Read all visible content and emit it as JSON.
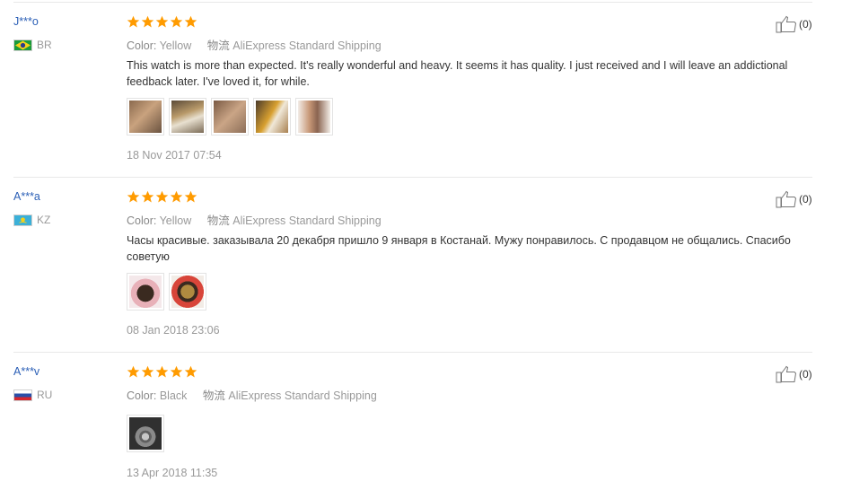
{
  "reviews": [
    {
      "user": "J***o",
      "country": "BR",
      "rating": 5,
      "color_label": "Color:",
      "color_value": "Yellow",
      "shipping_cn": "物流",
      "shipping": "AliExpress Standard Shipping",
      "text": "This watch is more than expected. It's really wonderful and heavy. It seems it has quality. I just received and I will leave an addictional feedback later. I've loved it, for while.",
      "date": "18 Nov 2017 07:54",
      "helpful_count": "(0)",
      "photo_count": 5
    },
    {
      "user": "A***a",
      "country": "KZ",
      "rating": 5,
      "color_label": "Color:",
      "color_value": "Yellow",
      "shipping_cn": "物流",
      "shipping": "AliExpress Standard Shipping",
      "text": "Часы красивые. заказывала 20 декабря пришло 9 января в Костанай. Мужу понравилось. С продавцом не общались. Спасибо советую",
      "date": "08 Jan 2018 23:06",
      "helpful_count": "(0)",
      "photo_count": 2
    },
    {
      "user": "A***v",
      "country": "RU",
      "rating": 5,
      "color_label": "Color:",
      "color_value": "Black",
      "shipping_cn": "物流",
      "shipping": "AliExpress Standard Shipping",
      "text": "",
      "date": "13 Apr 2018 11:35",
      "helpful_count": "(0)",
      "photo_count": 1
    }
  ],
  "colors": {
    "username": "#2b5fb6",
    "star": "#ff9b00",
    "muted": "#999999"
  },
  "icons": {
    "star": "star-icon",
    "helpful": "thumbs-up-icon"
  }
}
